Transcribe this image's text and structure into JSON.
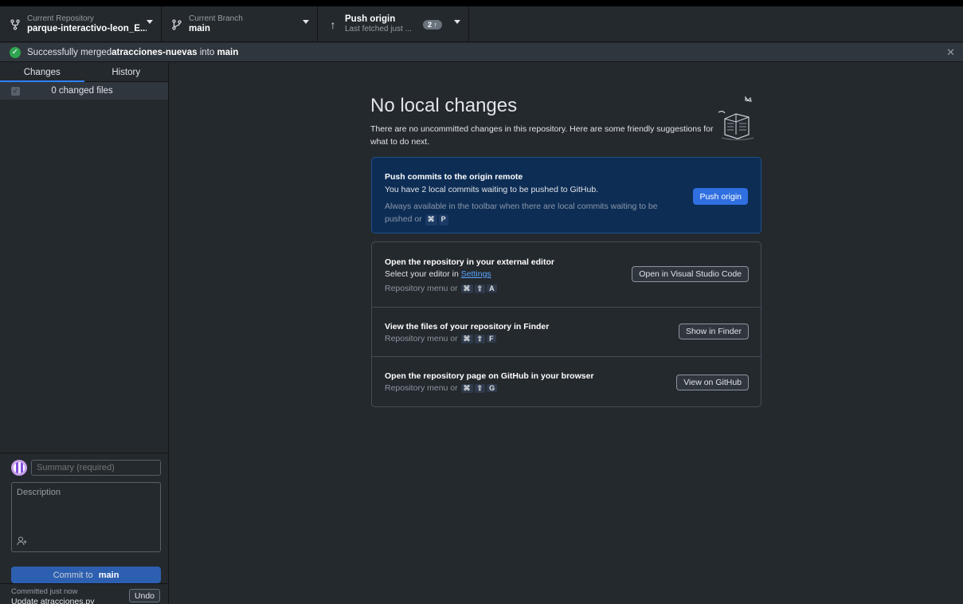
{
  "toolbar": {
    "repo": {
      "label": "Current Repository",
      "value": "parque-interactivo-leon_E..."
    },
    "branch": {
      "label": "Current Branch",
      "value": "main"
    },
    "push": {
      "label": "Push origin",
      "sub": "Last fetched just ...",
      "badge": "2 ↑"
    }
  },
  "banner": {
    "prefix": "Successfully merged ",
    "branch": "atracciones-nuevas",
    "middle": " into ",
    "target": "main"
  },
  "sidebar": {
    "tabs": [
      "Changes",
      "History"
    ],
    "changed_files": "0 changed files"
  },
  "commit": {
    "summary_placeholder": "Summary (required)",
    "description_placeholder": "Description",
    "button_prefix": "Commit to ",
    "button_branch": "main"
  },
  "last_commit": {
    "time": "Committed just now",
    "message": "Update atracciones.py",
    "undo": "Undo"
  },
  "main": {
    "title": "No local changes",
    "intro": "There are no uncommitted changes in this repository. Here are some friendly suggestions for what to do next.",
    "push_panel": {
      "title": "Push commits to the origin remote",
      "desc": "You have 2 local commits waiting to be pushed to GitHub.",
      "hint": "Always available in the toolbar when there are local commits waiting to be pushed or",
      "keys": [
        "⌘",
        "P"
      ],
      "button": "Push origin"
    },
    "editor": {
      "title": "Open the repository in your external editor",
      "desc_prefix": "Select your editor in ",
      "desc_link": "Settings",
      "hint": "Repository menu or",
      "keys": [
        "⌘",
        "⇧",
        "A"
      ],
      "button": "Open in Visual Studio Code"
    },
    "finder": {
      "title": "View the files of your repository in Finder",
      "hint": "Repository menu or",
      "keys": [
        "⌘",
        "⇧",
        "F"
      ],
      "button": "Show in Finder"
    },
    "github": {
      "title": "Open the repository page on GitHub in your browser",
      "hint": "Repository menu or",
      "keys": [
        "⌘",
        "⇧",
        "G"
      ],
      "button": "View on GitHub"
    }
  },
  "colors": {
    "background": "#24292e",
    "accent": "#2f81f7",
    "success": "#2ea44f",
    "push_panel": "#0d2d55"
  }
}
